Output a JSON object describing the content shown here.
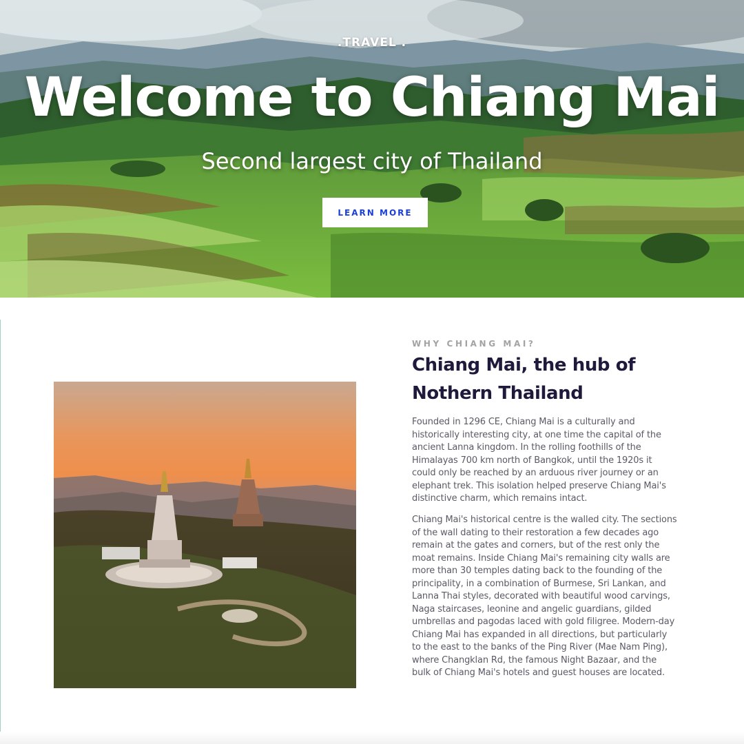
{
  "hero": {
    "brand": ".TRAVEL .",
    "title": "Welcome to Chiang Mai",
    "subtitle": "Second largest city of Thailand",
    "cta_label": "LEARN MORE"
  },
  "about": {
    "eyebrow": "WHY CHIANG MAI?",
    "heading": "Chiang Mai, the hub of Nothern Thailand",
    "paragraphs": [
      "Founded in 1296 CE, Chiang Mai is a culturally and historically interesting city, at one time the capital of the ancient Lanna kingdom. In the rolling foothills of the Himalayas 700 km north of Bangkok, until the 1920s it could only be reached by an arduous river journey or an elephant trek. This isolation helped preserve Chiang Mai's distinctive charm, which remains intact.",
      "Chiang Mai's historical centre is the walled city. The sections of the wall dating to their restoration a few decades ago remain at the gates and corners, but of the rest only the moat remains. Inside Chiang Mai's remaining city walls are more than 30 temples dating back to the founding of the principality, in a combination of Burmese, Sri Lankan, and Lanna Thai styles, decorated with beautiful wood carvings, Naga staircases, leonine and angelic guardians, gilded umbrellas and pagodas laced with gold filigree. Modern-day Chiang Mai has expanded in all directions, but particularly to the east to the banks of the Ping River (Mae Nam Ping), where Changklan Rd, the famous Night Bazaar, and the bulk of Chiang Mai's hotels and guest houses are located."
    ]
  },
  "colors": {
    "accent": "#1c3fd6",
    "heading": "#1f1a3b",
    "body_text": "#5a5a66",
    "eyebrow": "#a3a3a6"
  }
}
